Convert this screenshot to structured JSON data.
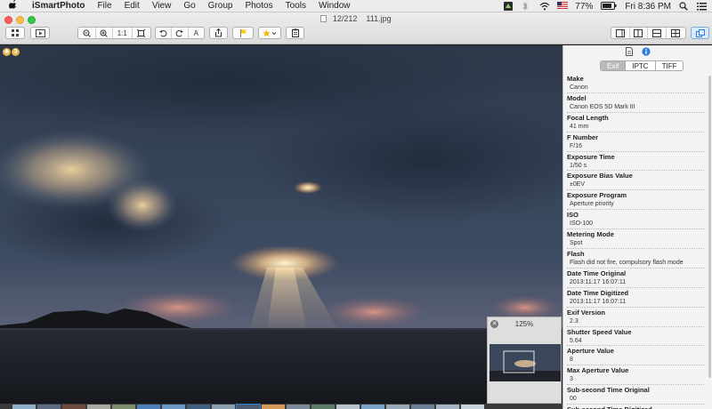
{
  "menubar": {
    "app_name": "iSmartPhoto",
    "menus": [
      "File",
      "Edit",
      "View",
      "Go",
      "Group",
      "Photos",
      "Tools",
      "Window"
    ],
    "battery": "77%",
    "clock": "Fri 8:36 PM"
  },
  "window": {
    "title_counter": "12/212",
    "title_file": "111.jpg"
  },
  "toolbar": {
    "actual_size_label": "1:1",
    "auto_enhance_label": "A"
  },
  "photo": {
    "badge_count": "3"
  },
  "navigator": {
    "zoom": "125%"
  },
  "inspector": {
    "tabs": [
      "Exif",
      "IPTC",
      "TIFF"
    ],
    "active_tab": "Exif",
    "exif": [
      {
        "label": "Make",
        "value": "Canon"
      },
      {
        "label": "Model",
        "value": "Canon EOS 5D Mark III"
      },
      {
        "label": "Focal Length",
        "value": "41 mm"
      },
      {
        "label": "F Number",
        "value": "F/16"
      },
      {
        "label": "Exposure Time",
        "value": "1/50 s"
      },
      {
        "label": "Exposure Bias Value",
        "value": "±0EV"
      },
      {
        "label": "Exposure Program",
        "value": "Aperture priority"
      },
      {
        "label": "ISO",
        "value": "ISO-100"
      },
      {
        "label": "Metering Mode",
        "value": "Spot"
      },
      {
        "label": "Flash",
        "value": "Flash did not fire, compulsory flash mode"
      },
      {
        "label": "Date Time Original",
        "value": "2013:11:17 16:07:11"
      },
      {
        "label": "Date Time Digitized",
        "value": "2013:11:17 16:07:11"
      },
      {
        "label": "Exif Version",
        "value": "2.3"
      },
      {
        "label": "Shutter Speed Value",
        "value": "5.64"
      },
      {
        "label": "Aperture Value",
        "value": "8"
      },
      {
        "label": "Max Aperture Value",
        "value": "3"
      },
      {
        "label": "Sub-second Time Original",
        "value": "00"
      },
      {
        "label": "Sub-second Time Digitized",
        "value": ""
      }
    ]
  },
  "colors": {
    "close": "#fc605c",
    "minimize": "#fdbc40",
    "maximize": "#34c84a",
    "selection_blue": "#2a7fe0",
    "star_gold": "#f0b400",
    "flag_yellow": "#ffcc00"
  }
}
